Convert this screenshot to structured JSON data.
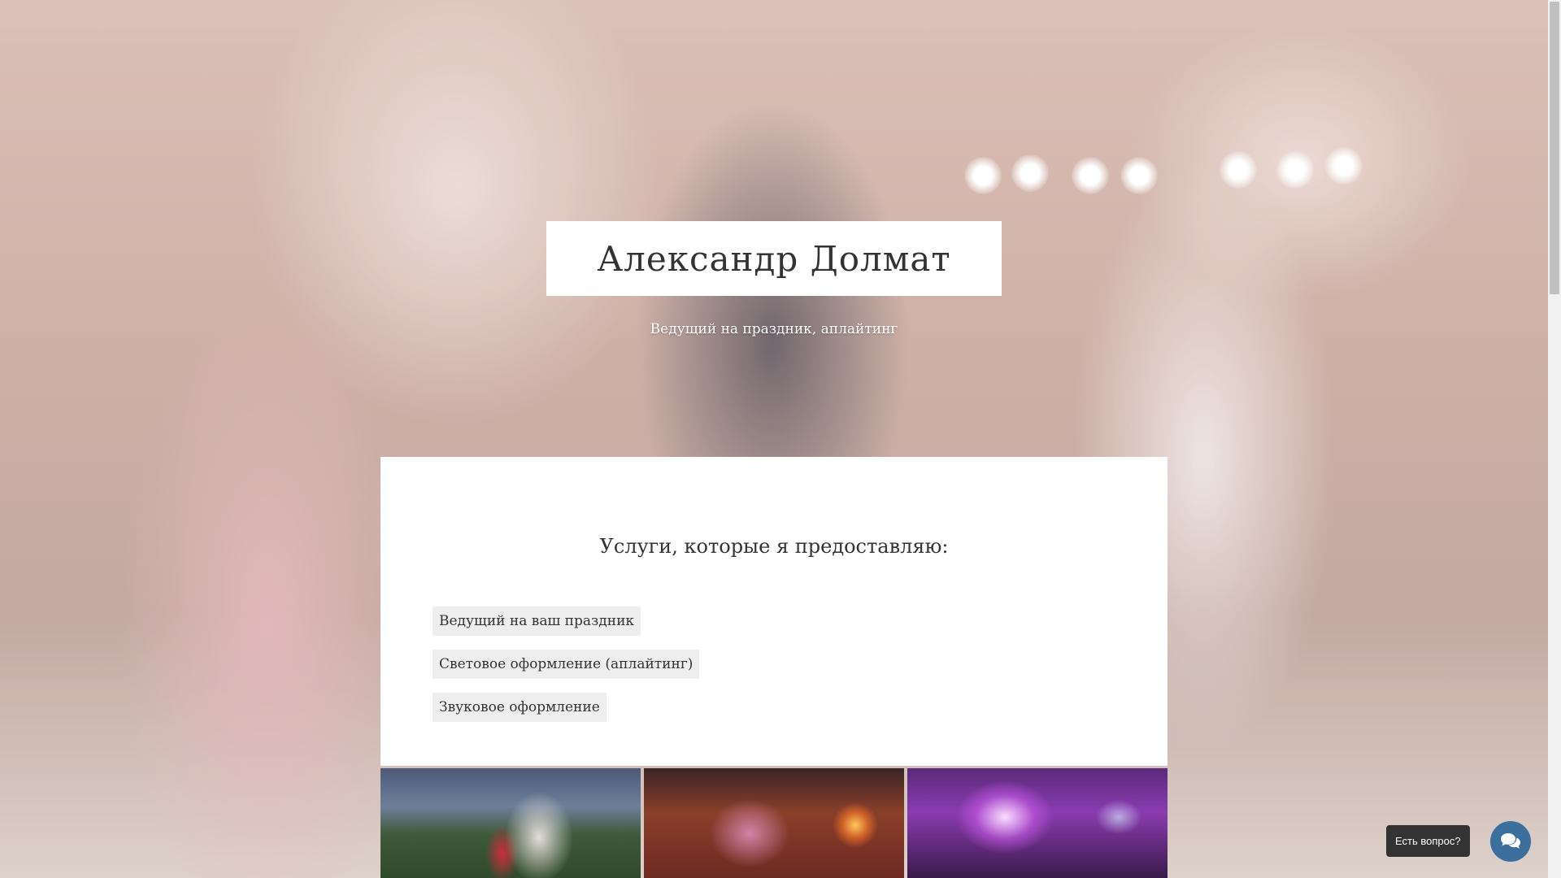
{
  "hero": {
    "title": "Александр Долмат",
    "subtitle": "Ведущий на праздник, аплайтинг"
  },
  "services": {
    "heading": "Услуги, которые я предоставляю:",
    "items": [
      {
        "label": "Ведущий на ваш праздник"
      },
      {
        "label": "Световое оформление (аплайтинг)"
      },
      {
        "label": "Звуковое оформление"
      }
    ]
  },
  "gallery": {
    "items": [
      {
        "name": "outdoor-ceremony-photo"
      },
      {
        "name": "hall-lighting-photo"
      },
      {
        "name": "dance-party-photo"
      }
    ]
  },
  "chat": {
    "tooltip": "Есть вопрос?",
    "icon": "chat-bubbles-icon",
    "button_color": "#3c6e9e"
  }
}
